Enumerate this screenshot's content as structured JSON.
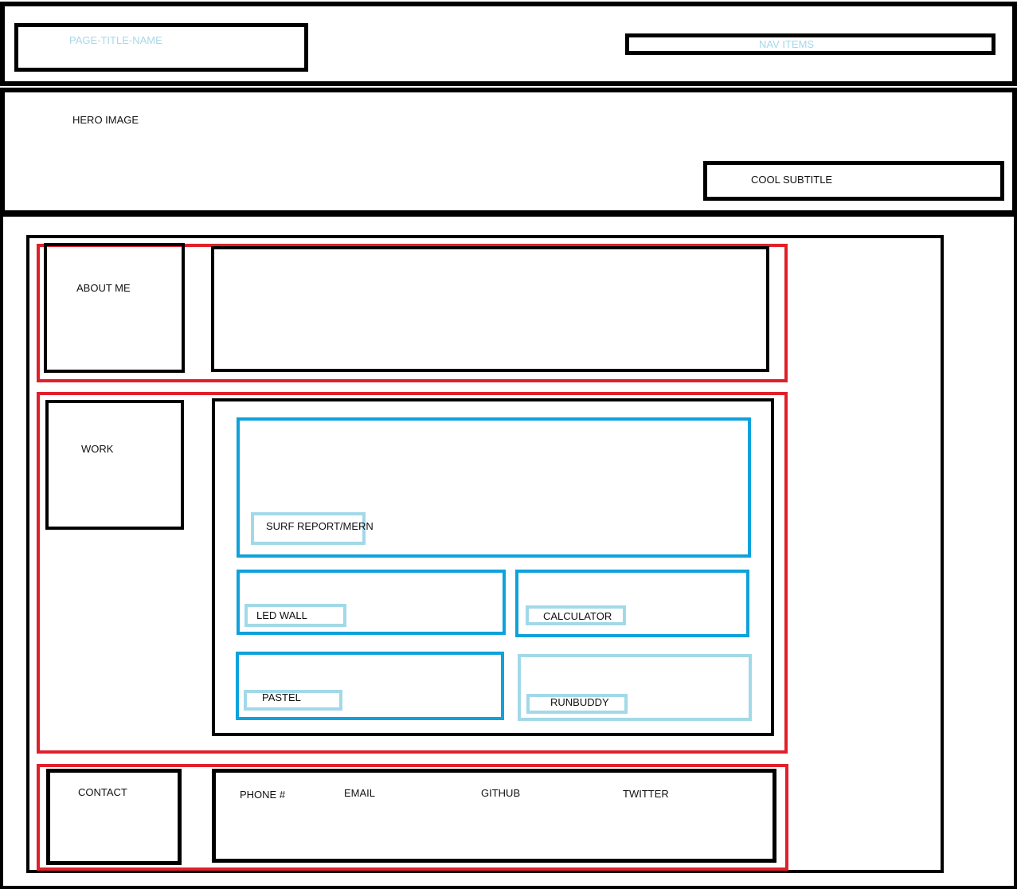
{
  "header": {
    "page_title": "PAGE-TITLE-NAME",
    "nav_label": "NAV ITEMS"
  },
  "hero": {
    "label": "HERO IMAGE",
    "subtitle": "COOL SUBTITLE"
  },
  "sections": {
    "about": {
      "heading": "ABOUT ME"
    },
    "work": {
      "heading": "WORK",
      "projects": [
        {
          "label": "SURF REPORT/MERN"
        },
        {
          "label": "LED WALL"
        },
        {
          "label": "CALCULATOR"
        },
        {
          "label": "PASTEL"
        },
        {
          "label": "RUNBUDDY"
        }
      ]
    },
    "contact": {
      "heading": "CONTACT",
      "items": [
        {
          "label": "PHONE #"
        },
        {
          "label": "EMAIL"
        },
        {
          "label": "GITHUB"
        },
        {
          "label": "TWITTER"
        }
      ]
    }
  },
  "colors": {
    "outline": "#000000",
    "section_outline": "#e0202a",
    "project_outline": "#0ea2dc",
    "label_outline": "#a2d9e8",
    "header_text": "#a6d8ea"
  }
}
